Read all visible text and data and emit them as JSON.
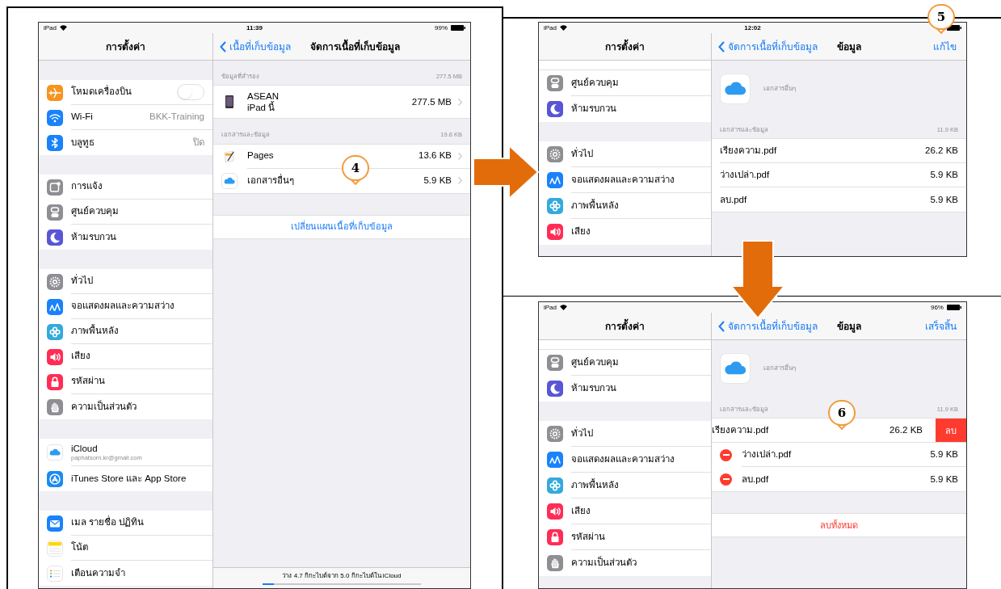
{
  "screens": [
    {
      "status": {
        "carrier": "iPad",
        "time": "11:39",
        "battery": "99%"
      },
      "sidebar": {
        "title": "การตั้งค่า",
        "scrolled": false,
        "groups": [
          [
            {
              "kind": "airplane",
              "label": "โหมดเครื่องบิน",
              "on": false
            },
            {
              "kind": "wifi",
              "label": "Wi-Fi",
              "value": "BKK-Training"
            },
            {
              "kind": "bluetooth",
              "label": "บลูทูธ",
              "value": "ปิด"
            }
          ],
          [
            {
              "kind": "notifications",
              "label": "การแจ้ง"
            },
            {
              "kind": "control",
              "label": "ศูนย์ควบคุม"
            },
            {
              "kind": "moon",
              "label": "ห้ามรบกวน"
            }
          ],
          [
            {
              "kind": "gear",
              "label": "ทั่วไป"
            },
            {
              "kind": "display",
              "label": "จอแสดงผลและความสว่าง"
            },
            {
              "kind": "flower",
              "label": "ภาพพื้นหลัง"
            },
            {
              "kind": "speaker",
              "label": "เสียง"
            },
            {
              "kind": "lock",
              "label": "รหัสผ่าน"
            },
            {
              "kind": "hand",
              "label": "ความเป็นส่วนตัว"
            }
          ],
          [
            {
              "kind": "cloud",
              "label": "iCloud",
              "sublabel": "paphatsorn.kr@gmail.com"
            },
            {
              "kind": "appstore",
              "label": "iTunes Store และ App Store"
            }
          ],
          [
            {
              "kind": "mail",
              "label": "เมล รายชื่อ ปฏิทิน"
            },
            {
              "kind": "notes",
              "label": "โน้ต"
            },
            {
              "kind": "reminders",
              "label": "เตือนความจำ"
            }
          ]
        ]
      },
      "detail": {
        "back": "เนื้อที่เก็บข้อมูล",
        "title": "จัดการเนื้อที่เก็บข้อมูล",
        "sections": [
          {
            "kind": "group",
            "header": "ข้อมูลที่สำรอง",
            "total": "277.5 MB",
            "rows": [
              {
                "kind": "device",
                "title": "ASEAN",
                "subtitle": "iPad นี้",
                "size": "277.5 MB",
                "chevron": true
              }
            ]
          },
          {
            "kind": "group",
            "header": "เอกสารและข้อมูล",
            "total": "19.6 KB",
            "rows": [
              {
                "kind": "pages",
                "title": "Pages",
                "size": "13.6 KB",
                "chevron": true
              },
              {
                "kind": "cloud",
                "title": "เอกสารอื่นๆ",
                "size": "5.9 KB",
                "chevron": true
              }
            ]
          },
          {
            "kind": "action",
            "label": "เปลี่ยนแผนเนื้อที่เก็บข้อมูล",
            "destructive": false
          }
        ],
        "footer": {
          "text": "ว่าง 4.7 กิกะไบต์จาก 5.0 กิกะไบต์ใน iCloud",
          "level": 0.07
        }
      }
    },
    {
      "status": {
        "carrier": "iPad",
        "time": "12:02"
      },
      "sidebar": {
        "title": "การตั้งค่า",
        "scrolled": true,
        "groups": [
          [
            {
              "kind": "control",
              "label": "ศูนย์ควบคุม"
            },
            {
              "kind": "moon",
              "label": "ห้ามรบกวน"
            }
          ],
          [
            {
              "kind": "gear",
              "label": "ทั่วไป"
            },
            {
              "kind": "display",
              "label": "จอแสดงผลและความสว่าง"
            },
            {
              "kind": "flower",
              "label": "ภาพพื้นหลัง"
            },
            {
              "kind": "speaker",
              "label": "เสียง"
            }
          ]
        ]
      },
      "detail": {
        "back": "จัดการเนื้อที่เก็บข้อมูล",
        "title": "ข้อมูล",
        "action": "แก้ไข",
        "sections": [
          {
            "kind": "app",
            "name": "เอกสารอื่นๆ"
          },
          {
            "kind": "group",
            "header": "เอกสารและข้อมูล",
            "total": "11.9 KB",
            "rows": [
              {
                "kind": "file",
                "title": "เรียงความ.pdf",
                "size": "26.2 KB",
                "editing": false,
                "swiped": false
              },
              {
                "kind": "file",
                "title": "ว่างเปล่า.pdf",
                "size": "5.9 KB",
                "editing": false,
                "swiped": false
              },
              {
                "kind": "file",
                "title": "ลบ.pdf",
                "size": "5.9 KB",
                "editing": false,
                "swiped": false
              }
            ]
          }
        ]
      }
    },
    {
      "status": {
        "carrier": "iPad",
        "battery": "96%"
      },
      "sidebar": {
        "title": "การตั้งค่า",
        "scrolled": true,
        "groups": [
          [
            {
              "kind": "control",
              "label": "ศูนย์ควบคุม"
            },
            {
              "kind": "moon",
              "label": "ห้ามรบกวน"
            }
          ],
          [
            {
              "kind": "gear",
              "label": "ทั่วไป"
            },
            {
              "kind": "display",
              "label": "จอแสดงผลและความสว่าง"
            },
            {
              "kind": "flower",
              "label": "ภาพพื้นหลัง"
            },
            {
              "kind": "speaker",
              "label": "เสียง"
            },
            {
              "kind": "lock",
              "label": "รหัสผ่าน"
            },
            {
              "kind": "hand",
              "label": "ความเป็นส่วนตัว"
            }
          ]
        ]
      },
      "detail": {
        "back": "จัดการเนื้อที่เก็บข้อมูล",
        "title": "ข้อมูล",
        "action": "เสร็จสิ้น",
        "sections": [
          {
            "kind": "app",
            "name": "เอกสารอื่นๆ"
          },
          {
            "kind": "group",
            "header": "เอกสารและข้อมูล",
            "total": "11.9 KB",
            "rows": [
              {
                "kind": "file",
                "title": "เรียงความ.pdf",
                "size": "26.2 KB",
                "editing": true,
                "swiped": true,
                "delete_label": "ลบ"
              },
              {
                "kind": "file",
                "title": "ว่างเปล่า.pdf",
                "size": "5.9 KB",
                "editing": true,
                "swiped": false
              },
              {
                "kind": "file",
                "title": "ลบ.pdf",
                "size": "5.9 KB",
                "editing": true,
                "swiped": false
              }
            ]
          },
          {
            "kind": "action",
            "label": "ลบทั้งหมด",
            "destructive": true
          }
        ]
      }
    }
  ],
  "callouts": [
    {
      "label": "4"
    },
    {
      "label": "5"
    },
    {
      "label": "6"
    }
  ]
}
